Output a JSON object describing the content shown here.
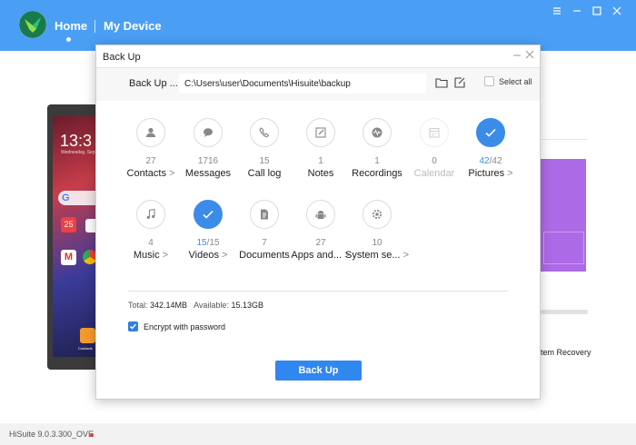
{
  "app": {
    "nav_home": "Home",
    "nav_device": "My Device",
    "accent": "#4a9ff5",
    "window_controls": [
      "menu-icon",
      "minimize-icon",
      "maximize-icon",
      "close-icon"
    ]
  },
  "background": {
    "phone": {
      "time": "13:3",
      "date": "Wednesday, Sep",
      "search_glyph": "G",
      "calendar_day": "25",
      "gmail_glyph": "M",
      "contacts_label": "Contacts"
    },
    "recovery_label": "tem Recovery",
    "purple": "#ad6ae6"
  },
  "status": {
    "version": "HiSuite 9.0.3.300_OVE"
  },
  "dialog": {
    "title": "Back Up",
    "path_label": "Back Up ...",
    "path_value": "C:\\Users\\user\\Documents\\Hisuite\\backup",
    "select_all": "Select all",
    "categories": [
      {
        "name": "Contacts",
        "arrow": ">",
        "count": "27",
        "total": "",
        "selected": false,
        "disabled": false,
        "icon": "person-icon"
      },
      {
        "name": "Messages",
        "arrow": "",
        "count": "1716",
        "total": "",
        "selected": false,
        "disabled": false,
        "icon": "message-icon"
      },
      {
        "name": "Call log",
        "arrow": "",
        "count": "15",
        "total": "",
        "selected": false,
        "disabled": false,
        "icon": "phone-icon"
      },
      {
        "name": "Notes",
        "arrow": "",
        "count": "1",
        "total": "",
        "selected": false,
        "disabled": false,
        "icon": "note-icon"
      },
      {
        "name": "Recordings",
        "arrow": "",
        "count": "1",
        "total": "",
        "selected": false,
        "disabled": false,
        "icon": "waveform-icon"
      },
      {
        "name": "Calendar",
        "arrow": "",
        "count": "0",
        "total": "",
        "selected": false,
        "disabled": true,
        "icon": "calendar-icon"
      },
      {
        "name": "Pictures",
        "arrow": ">",
        "count": "42",
        "total": "/42",
        "selected": true,
        "disabled": false,
        "icon": "check-icon"
      },
      {
        "name": "Music",
        "arrow": ">",
        "count": "4",
        "total": "",
        "selected": false,
        "disabled": false,
        "icon": "music-icon"
      },
      {
        "name": "Videos",
        "arrow": ">",
        "count": "15",
        "total": "/15",
        "selected": true,
        "disabled": false,
        "icon": "check-icon"
      },
      {
        "name": "Documents",
        "arrow": "",
        "count": "7",
        "total": "",
        "selected": false,
        "disabled": false,
        "icon": "document-icon"
      },
      {
        "name": "Apps and...",
        "arrow": ">",
        "count": "27",
        "total": "",
        "selected": false,
        "disabled": false,
        "icon": "android-icon"
      },
      {
        "name": "System se...",
        "arrow": ">",
        "count": "10",
        "total": "",
        "selected": false,
        "disabled": false,
        "icon": "gear-icon"
      }
    ],
    "total_label": "Total:",
    "total_value": "342.14MB",
    "available_label": "Available:",
    "available_value": "15.13GB",
    "encrypt_label": "Encrypt with password",
    "encrypt_checked": true,
    "backup_button": "Back Up",
    "selected_color": "#3b8ce8"
  }
}
